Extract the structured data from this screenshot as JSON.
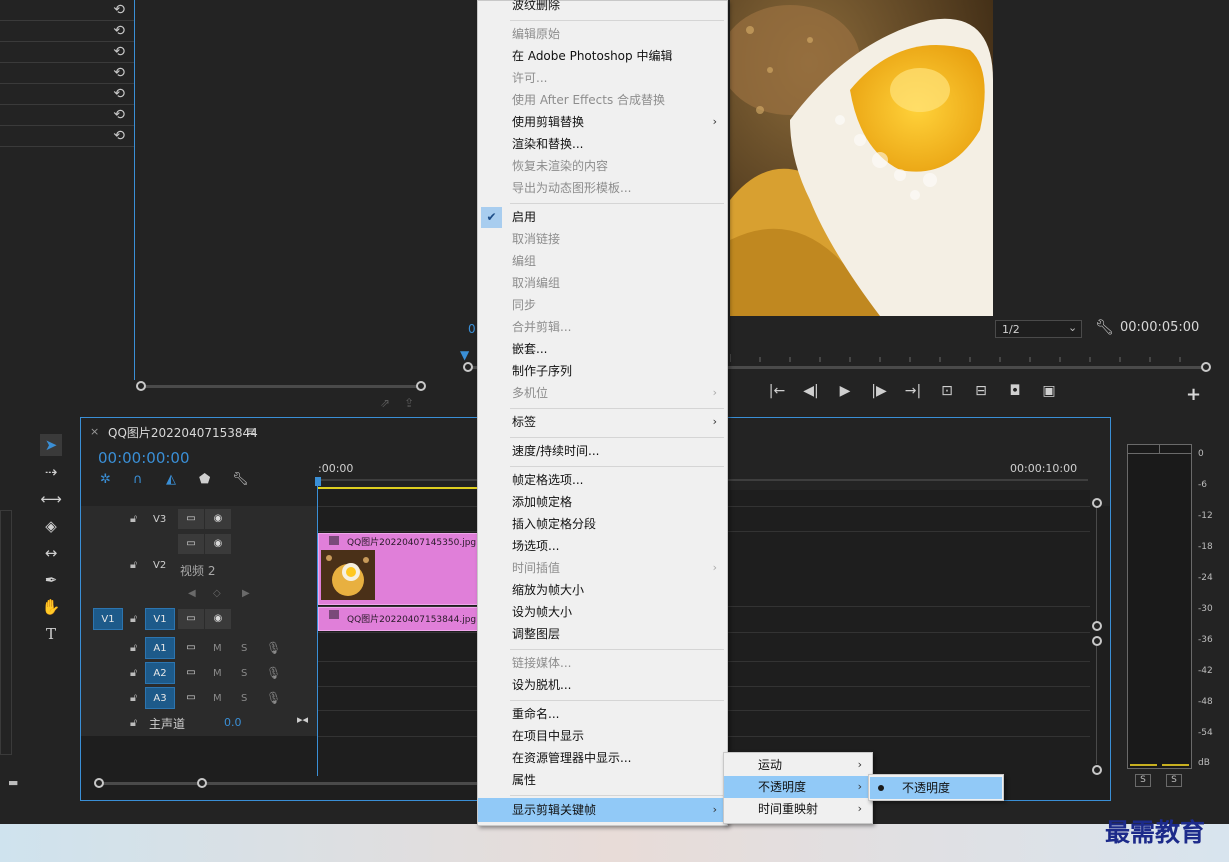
{
  "context_menu": {
    "items": [
      {
        "label": "波纹删除",
        "enabled": true,
        "submenu": false
      },
      {
        "label": "编辑原始",
        "enabled": false,
        "submenu": false
      },
      {
        "label": "在 Adobe Photoshop 中编辑",
        "enabled": true,
        "submenu": false
      },
      {
        "label": "许可...",
        "enabled": false,
        "submenu": false
      },
      {
        "label": "使用 After Effects 合成替换",
        "enabled": false,
        "submenu": false
      },
      {
        "label": "使用剪辑替换",
        "enabled": true,
        "submenu": true
      },
      {
        "label": "渲染和替换...",
        "enabled": true,
        "submenu": false
      },
      {
        "label": "恢复未渲染的内容",
        "enabled": false,
        "submenu": false
      },
      {
        "label": "导出为动态图形模板...",
        "enabled": false,
        "submenu": false
      },
      {
        "label": "启用",
        "enabled": true,
        "submenu": false,
        "checked": true
      },
      {
        "label": "取消链接",
        "enabled": false,
        "submenu": false
      },
      {
        "label": "编组",
        "enabled": false,
        "submenu": false
      },
      {
        "label": "取消编组",
        "enabled": false,
        "submenu": false
      },
      {
        "label": "同步",
        "enabled": false,
        "submenu": false
      },
      {
        "label": "合并剪辑...",
        "enabled": false,
        "submenu": false
      },
      {
        "label": "嵌套...",
        "enabled": true,
        "submenu": false
      },
      {
        "label": "制作子序列",
        "enabled": true,
        "submenu": false
      },
      {
        "label": "多机位",
        "enabled": false,
        "submenu": true
      },
      {
        "label": "标签",
        "enabled": true,
        "submenu": true
      },
      {
        "label": "速度/持续时间...",
        "enabled": true,
        "submenu": false
      },
      {
        "label": "帧定格选项...",
        "enabled": true,
        "submenu": false
      },
      {
        "label": "添加帧定格",
        "enabled": true,
        "submenu": false
      },
      {
        "label": "插入帧定格分段",
        "enabled": true,
        "submenu": false
      },
      {
        "label": "场选项...",
        "enabled": true,
        "submenu": false
      },
      {
        "label": "时间插值",
        "enabled": false,
        "submenu": true
      },
      {
        "label": "缩放为帧大小",
        "enabled": true,
        "submenu": false
      },
      {
        "label": "设为帧大小",
        "enabled": true,
        "submenu": false
      },
      {
        "label": "调整图层",
        "enabled": true,
        "submenu": false
      },
      {
        "label": "链接媒体...",
        "enabled": false,
        "submenu": false
      },
      {
        "label": "设为脱机...",
        "enabled": true,
        "submenu": false
      },
      {
        "label": "重命名...",
        "enabled": true,
        "submenu": false
      },
      {
        "label": "在项目中显示",
        "enabled": true,
        "submenu": false
      },
      {
        "label": "在资源管理器中显示...",
        "enabled": true,
        "submenu": false
      },
      {
        "label": "属性",
        "enabled": true,
        "submenu": false
      },
      {
        "label": "显示剪辑关键帧",
        "enabled": true,
        "submenu": true,
        "highlighted": true
      }
    ]
  },
  "submenu_keyframes": {
    "items": [
      {
        "label": "运动",
        "highlighted": false
      },
      {
        "label": "不透明度",
        "highlighted": true
      },
      {
        "label": "时间重映射",
        "highlighted": false
      }
    ]
  },
  "submenu_opacity": {
    "item": "不透明度"
  },
  "program_monitor": {
    "time_left": "0",
    "resolution": "1/2",
    "duration": "00:00:05:00"
  },
  "timeline": {
    "tab_title": "QQ图片20220407153844",
    "tab_close": "×",
    "tab_menu": "≡",
    "timecode": "00:00:00:00",
    "ruler_start": ":00:00",
    "ruler_mark": "00:00:10:00",
    "tracks": {
      "v3": "V3",
      "v2": "V2",
      "v2_name": "视频 2",
      "v1_src": "V1",
      "v1": "V1",
      "a1": "A1",
      "a2": "A2",
      "a3": "A3",
      "mute": "M",
      "solo": "S",
      "master_label": "主声道",
      "master_volume": "0.0"
    },
    "clips": [
      {
        "name": "QQ图片20220407145350.jpg",
        "track": "V2"
      },
      {
        "name": "QQ图片20220407153844.jpg",
        "track": "V1"
      }
    ]
  },
  "audio_meter": {
    "db_marks": [
      "0",
      "-6",
      "-12",
      "-18",
      "-24",
      "-30",
      "-36",
      "-42",
      "-48",
      "-54",
      "dB"
    ],
    "solo_left": "S",
    "solo_right": "S"
  },
  "watermark": "最需教育",
  "colors": {
    "accent": "#3a8fd6",
    "clip": "#e07fd9",
    "menu_highlight": "#91c9f7",
    "menu_bg": "#f0f0f0"
  }
}
